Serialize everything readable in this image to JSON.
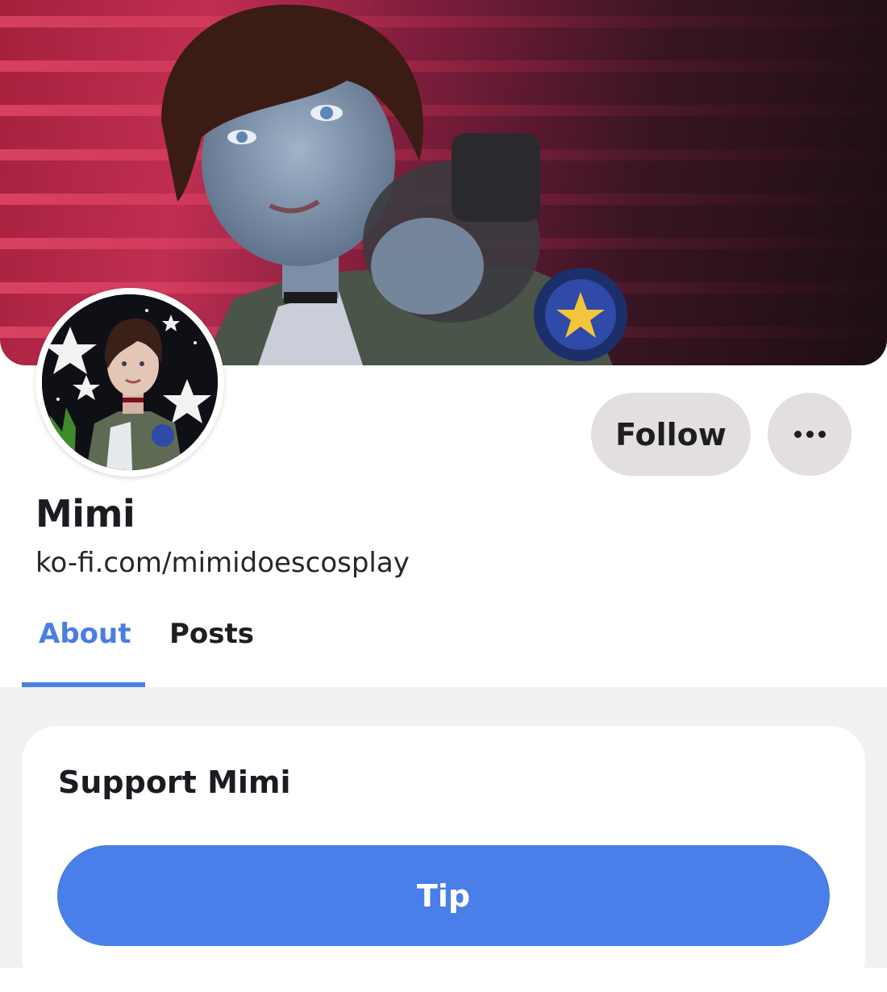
{
  "profile": {
    "name": "Mimi",
    "link": "ko-fi.com/mimidoescosplay"
  },
  "actions": {
    "follow_label": "Follow",
    "more_icon": "ellipsis-icon"
  },
  "tabs": [
    {
      "label": "About",
      "active": true
    },
    {
      "label": "Posts",
      "active": false
    }
  ],
  "support": {
    "title": "Support Mimi",
    "tip_label": "Tip"
  },
  "colors": {
    "accent": "#4a7ee8",
    "button_gray": "#e3dfdf",
    "page_background": "#f1f1f4"
  }
}
